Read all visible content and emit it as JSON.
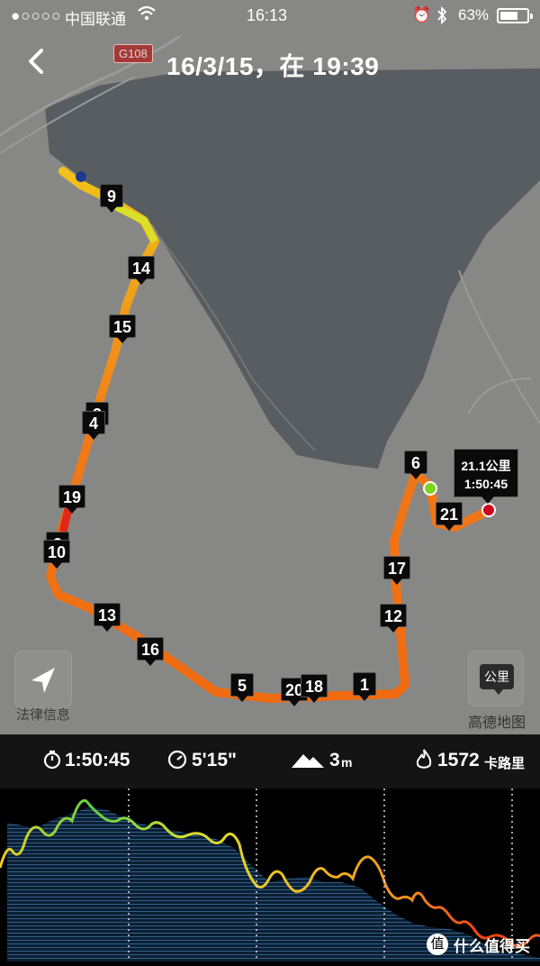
{
  "status_bar": {
    "signal": "●○○○○",
    "carrier": "中国联通",
    "time": "16:13",
    "battery": "63%"
  },
  "header": {
    "title": "16/3/15，在 19:39",
    "road_badge": "G108"
  },
  "map": {
    "km_markers": [
      {
        "label": "9"
      },
      {
        "label": "14"
      },
      {
        "label": "15"
      },
      {
        "label": "3"
      },
      {
        "label": "4"
      },
      {
        "label": "19"
      },
      {
        "label": "2"
      },
      {
        "label": "10"
      },
      {
        "label": "13"
      },
      {
        "label": "16"
      },
      {
        "label": "5"
      },
      {
        "label": "20"
      },
      {
        "label": "18"
      },
      {
        "label": "1"
      },
      {
        "label": "12"
      },
      {
        "label": "17"
      },
      {
        "label": "6"
      },
      {
        "label": "21"
      }
    ],
    "finish_tooltip": {
      "distance": "21.1公里",
      "time": "1:50:45"
    },
    "legal_text": "法律信息",
    "unit_button": "公里",
    "map_provider": "高德地图"
  },
  "stats": {
    "duration": "1:50:45",
    "pace": "5'15\"",
    "elevation": "3",
    "elevation_unit": "m",
    "calories": "1572",
    "calories_unit": "卡路里"
  },
  "watermark": {
    "icon": "值",
    "text": "什么值得买"
  }
}
